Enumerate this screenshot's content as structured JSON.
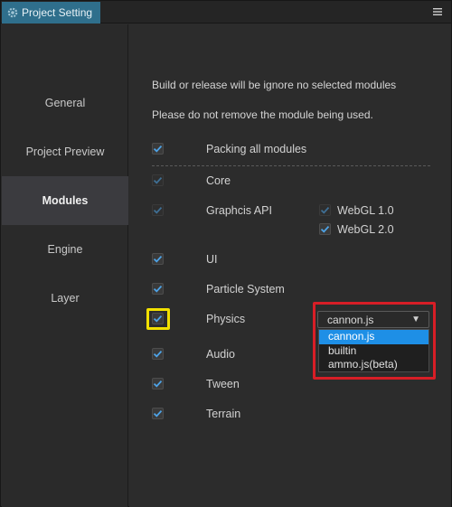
{
  "window": {
    "tab_title": "Project Setting",
    "menu_icon": "hamburger-icon"
  },
  "sidebar": {
    "items": [
      {
        "label": "General",
        "active": false
      },
      {
        "label": "Project Preview",
        "active": false
      },
      {
        "label": "Modules",
        "active": true
      },
      {
        "label": "Engine",
        "active": false
      },
      {
        "label": "Layer",
        "active": false
      }
    ]
  },
  "modules": {
    "note_1": "Build or release will be ignore no selected modules",
    "note_2": "Please do not remove the module being used.",
    "packing_all": {
      "label": "Packing all modules",
      "checked": true
    },
    "core": {
      "label": "Core",
      "checked": true,
      "disabled": true
    },
    "graphics_api": {
      "label": "Graphcis API",
      "checked": true,
      "disabled": true,
      "options": [
        {
          "label": "WebGL 1.0",
          "checked": true,
          "disabled": true
        },
        {
          "label": "WebGL 2.0",
          "checked": true,
          "disabled": false
        }
      ]
    },
    "ui": {
      "label": "UI",
      "checked": true
    },
    "particle_system": {
      "label": "Particle System",
      "checked": true
    },
    "physics": {
      "label": "Physics",
      "checked": true,
      "engine_select": {
        "value": "cannon.js",
        "options": [
          "cannon.js",
          "builtin",
          "ammo.js(beta)"
        ],
        "highlighted": "cannon.js"
      }
    },
    "audio": {
      "label": "Audio",
      "checked": true
    },
    "tween": {
      "label": "Tween",
      "checked": true
    },
    "terrain": {
      "label": "Terrain",
      "checked": true
    }
  },
  "colors": {
    "accent_tab": "#2f6f8c",
    "check_enabled": "#4ea3e6",
    "check_disabled": "#3f6f94",
    "highlight_yellow": "#f2e000",
    "highlight_red": "#d81e26",
    "option_selected": "#1e8fe6"
  }
}
